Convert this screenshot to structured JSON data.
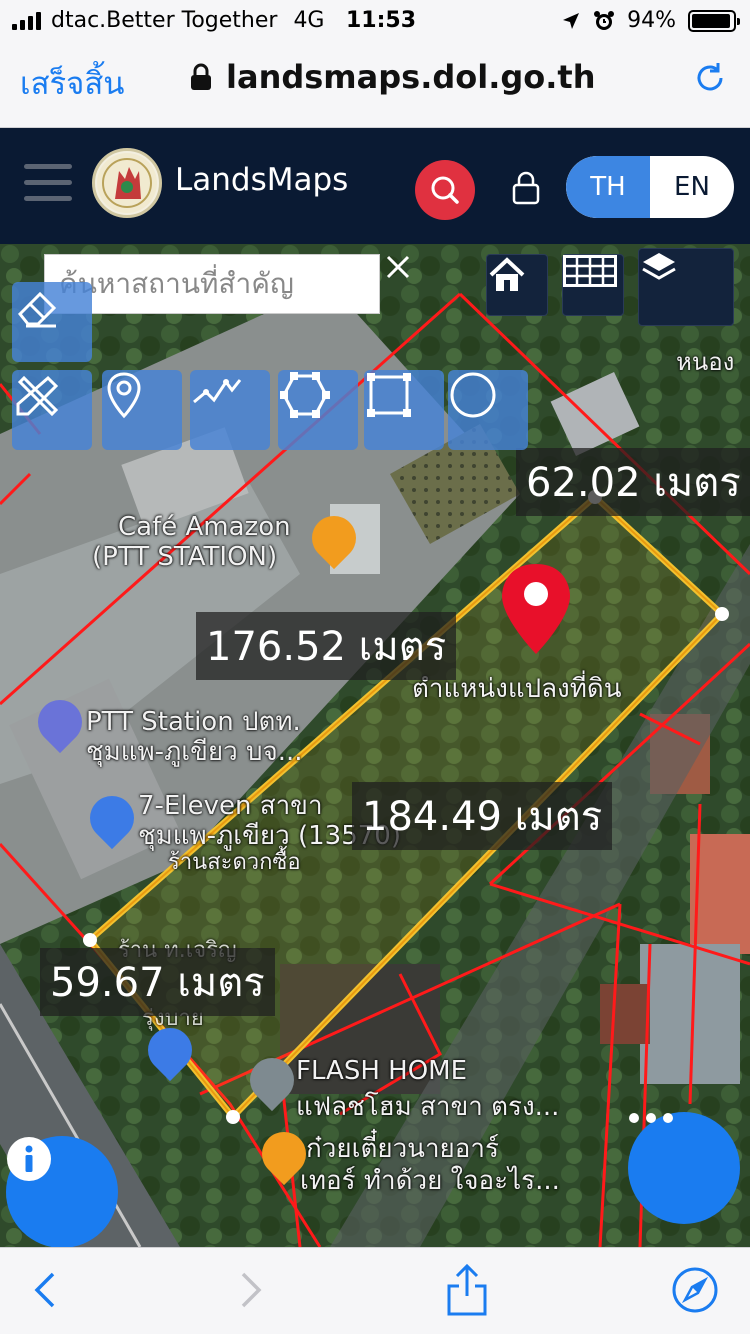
{
  "status_bar": {
    "carrier": "dtac.Better Together",
    "network": "4G",
    "time": "11:53",
    "battery": "94%",
    "battery_level": 0.94
  },
  "browser": {
    "done_label": "เสร็จสิ้น",
    "url": "landsmaps.dol.go.th"
  },
  "app": {
    "title": "LandsMaps",
    "lang_th": "TH",
    "lang_en": "EN",
    "lang_selected": "TH"
  },
  "map": {
    "search_placeholder": "ค้นหาสถานที่สำคัญ",
    "measurements": [
      "62.02 เมตร",
      "176.52 เมตร",
      "184.49 เมตร",
      "59.67 เมตร"
    ],
    "marker_label": "ตำแหน่งแปลงที่ดิน",
    "places": {
      "cafe_line1": "Café Amazon",
      "cafe_line2": "(PTT STATION)",
      "ptt_line1": "PTT Station ปตท.",
      "ptt_line2": "ชุมแพ-ภูเขียว บจ...",
      "seven_line1": "7-Eleven สาขา",
      "seven_line2": "ชุมแพ-ภูเขียว (13570)",
      "seven_line3": "ร้านสะดวกซื้อ",
      "flash_line1": "FLASH HOME",
      "flash_line2": "แฟลชโฮม สาขา ตรง...",
      "noodle_line1": "ก๋วยเตี๋ยวนายอาร์",
      "noodle_line2": "เทอร์ ทำด้วย ใจอะไร...",
      "nong": "หนอง",
      "shop_partial": "ร้าน ท.เจริญ",
      "shop_partial2": "รุ่งบาย"
    }
  },
  "colors": {
    "accent": "#1a7cf0",
    "header_bg": "#0a1a33",
    "search_red": "#e03140",
    "parcel_red": "#ff1a1a",
    "measure_yellow": "#f2c12e",
    "marker_red": "#e8102a"
  }
}
